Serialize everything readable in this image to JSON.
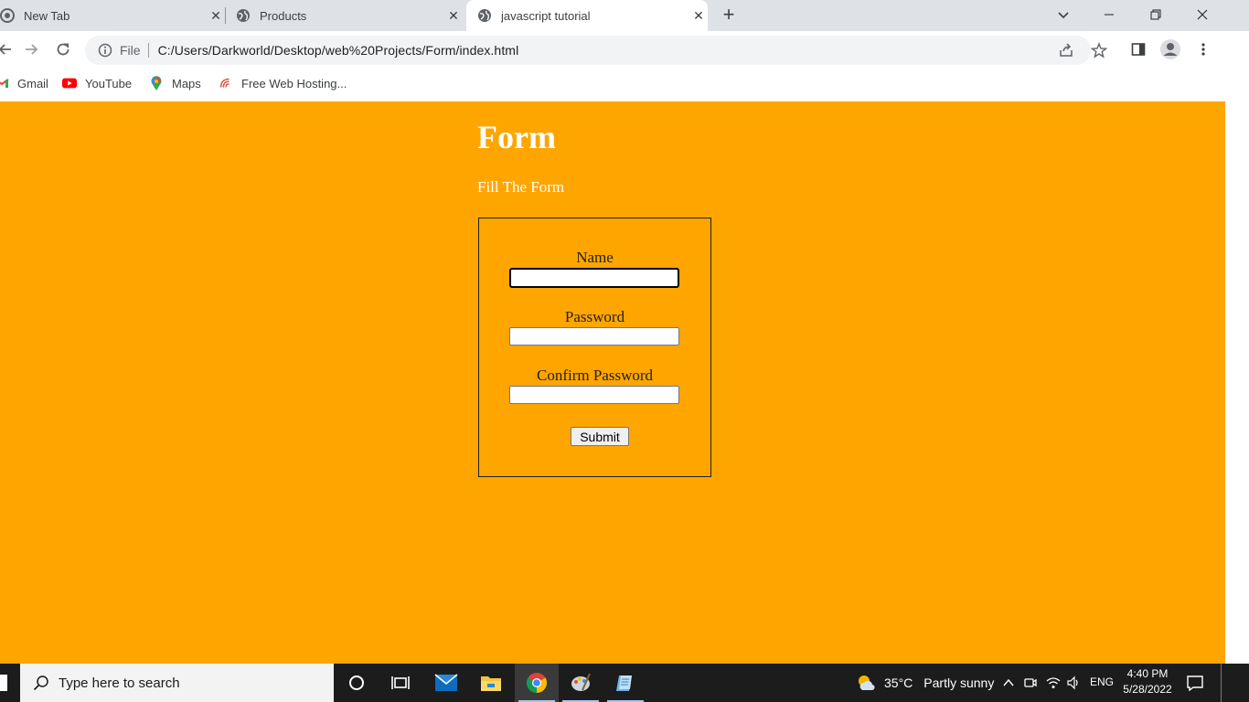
{
  "browser": {
    "tabs": [
      {
        "title": "New Tab",
        "icon": "chrome-icon"
      },
      {
        "title": "Products",
        "icon": "globe-icon"
      },
      {
        "title": "javascript tutorial",
        "icon": "globe-icon",
        "active": true
      }
    ],
    "address": {
      "scheme": "File",
      "url": "C:/Users/Darkworld/Desktop/web%20Projects/Form/index.html"
    },
    "bookmarks": [
      {
        "label": "Gmail",
        "icon": "gmail-icon"
      },
      {
        "label": "YouTube",
        "icon": "youtube-icon"
      },
      {
        "label": "Maps",
        "icon": "maps-icon"
      },
      {
        "label": "Free Web Hosting...",
        "icon": "hosting-icon"
      }
    ]
  },
  "page": {
    "background": "#ffa500",
    "title": "Form",
    "subtitle": "Fill The Form",
    "form": {
      "name_label": "Name",
      "name_value": "",
      "password_label": "Password",
      "password_value": "",
      "confirm_label": "Confirm Password",
      "confirm_value": "",
      "submit_label": "Submit"
    }
  },
  "taskbar": {
    "search_placeholder": "Type here to search",
    "weather": {
      "temp": "35°C",
      "condition": "Partly sunny"
    },
    "language": "ENG",
    "time": "4:40 PM",
    "date": "5/28/2022"
  }
}
